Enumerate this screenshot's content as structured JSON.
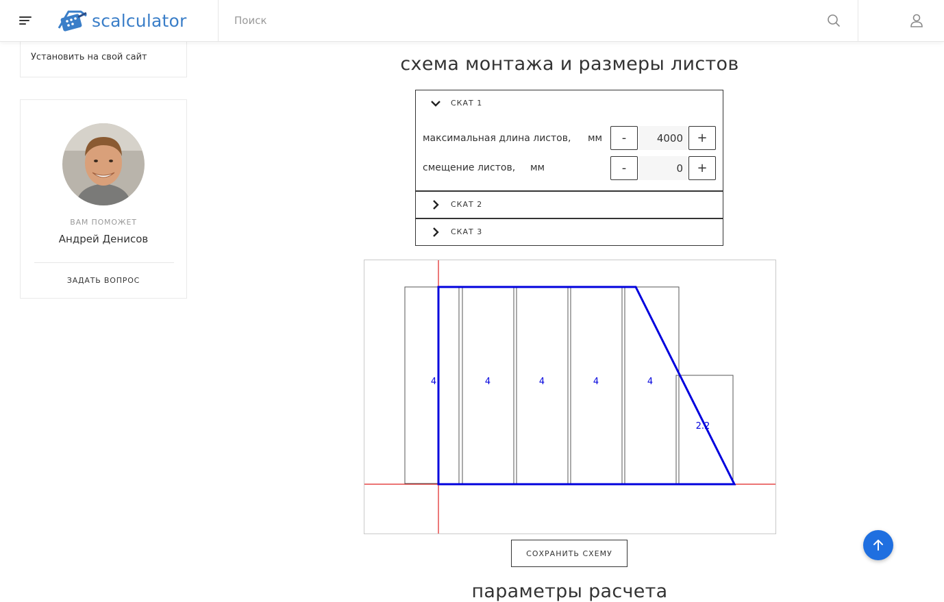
{
  "header": {
    "logo_text": "scalculator",
    "search_placeholder": "Поиск"
  },
  "sidebar": {
    "install_link": "Установить на свой сайт",
    "helper": {
      "caption": "ВАМ ПОМОЖЕТ",
      "name": "Андрей Денисов",
      "ask_link": "ЗАДАТЬ ВОПРОС"
    }
  },
  "main": {
    "scheme_title": "схема монтажа и размеры листов",
    "params_title": "параметры расчета",
    "slopes": [
      {
        "label": "СКАТ 1",
        "expanded": true
      },
      {
        "label": "СКАТ 2",
        "expanded": false
      },
      {
        "label": "СКАТ 3",
        "expanded": false
      }
    ],
    "slope1_params": {
      "max_length": {
        "label": "максимальная длина листов,",
        "unit": "мм",
        "value": "4000",
        "minus": "-",
        "plus": "+"
      },
      "offset": {
        "label": "смещение листов,",
        "unit": "мм",
        "value": "0",
        "minus": "-",
        "plus": "+"
      }
    },
    "scheme": {
      "sheet_labels": [
        "4",
        "4",
        "4",
        "4",
        "4",
        "2.2"
      ],
      "colors": {
        "outline": "#0000dd",
        "axis": "#e02020",
        "sheet": "#555555",
        "label": "#0000dd"
      }
    },
    "save_button": "СОХРАНИТЬ СХЕМУ"
  },
  "colors": {
    "accent": "#1f6fe0",
    "logo": "#3a7ec8"
  }
}
